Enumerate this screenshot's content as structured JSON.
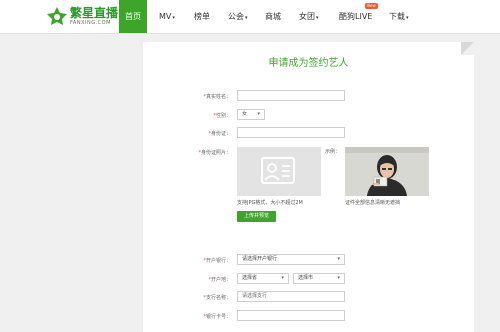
{
  "brand": {
    "name_cn": "繁星直播",
    "name_en": "FANXING.COM",
    "green": "#3da52a"
  },
  "nav": {
    "items": [
      {
        "label": "首页",
        "active": true
      },
      {
        "label": "MV",
        "dropdown": true
      },
      {
        "label": "榜单"
      },
      {
        "label": "公会",
        "dropdown": true
      },
      {
        "label": "商城"
      },
      {
        "label": "女团",
        "dropdown": true
      },
      {
        "label": "酷狗LIVE",
        "badge": "New"
      },
      {
        "label": "下载",
        "dropdown": true
      }
    ]
  },
  "form": {
    "title": "申请成为签约艺人",
    "required_mark": "*",
    "name_label": "真实姓名：",
    "gender_label": "性别：",
    "gender_value": "女",
    "id_label": "身份证：",
    "id_photo_label": "身份证照片：",
    "example_label": "示例：",
    "photo_hint": "支持JPG格式，大小不超过2M",
    "example_hint": "证件全部信息清晰无遮挡",
    "upload_button": "上传并预览",
    "bank_label": "开户银行：",
    "bank_value": "请选择开户银行",
    "location_label": "开户地：",
    "province_value": "选择省",
    "city_value": "选择市",
    "branch_label": "支行名称：",
    "branch_placeholder": "请选择支行",
    "card_label": "银行卡号："
  }
}
